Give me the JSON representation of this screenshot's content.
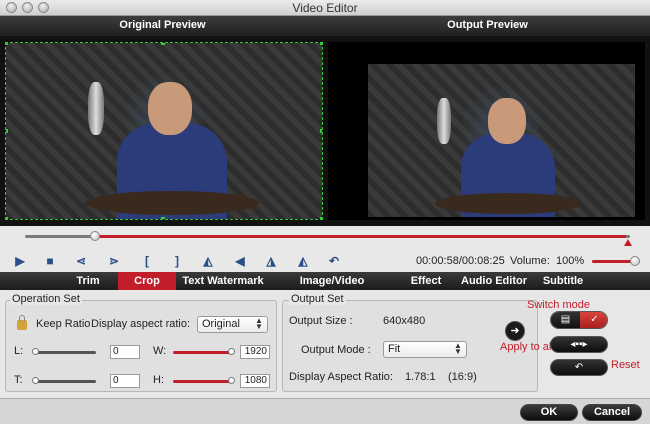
{
  "window": {
    "title": "Video Editor"
  },
  "preview": {
    "original_label": "Original Preview",
    "output_label": "Output Preview"
  },
  "playback": {
    "position_fraction": 0.115,
    "time_current": "00:00:58",
    "time_total": "00:08:25",
    "time_text": "00:00:58/00:08:25",
    "volume_label": "Volume:",
    "volume_value": "100%",
    "volume_fraction": 1.0,
    "buttons": [
      "play-icon",
      "stop-icon",
      "trim-start-icon",
      "trim-end-icon",
      "mark-in-icon",
      "mark-out-icon",
      "flip-horizontal-icon",
      "flip-vertical-icon",
      "rotate-left-icon",
      "rotate-right-icon",
      "undo-icon"
    ]
  },
  "tabs": [
    {
      "label": "Trim"
    },
    {
      "label": "Crop",
      "active": true
    },
    {
      "label": "Text Watermark"
    },
    {
      "label": "Image/Video Watermark"
    },
    {
      "label": "Effect"
    },
    {
      "label": "Audio Editor"
    },
    {
      "label": "Subtitle"
    }
  ],
  "operation_set": {
    "title": "Operation Set",
    "keep_ratio_label": "Keep Ratio",
    "display_aspect_label": "Display aspect ratio:",
    "display_aspect_value": "Original",
    "L_label": "L:",
    "L_value": "0",
    "W_label": "W:",
    "W_value": "1920",
    "T_label": "T:",
    "T_value": "0",
    "H_label": "H:",
    "H_value": "1080"
  },
  "output_set": {
    "title": "Output Set",
    "size_label": "Output Size :",
    "size_value": "640x480",
    "mode_label": "Output Mode :",
    "mode_value": "Fit",
    "dar_label": "Display Aspect Ratio:",
    "dar_value": "1.78:1",
    "dar_extra": "(16:9)"
  },
  "side": {
    "switch_mode": "Switch mode",
    "apply_to_all": "Apply to all",
    "reset": "Reset"
  },
  "footer": {
    "ok": "OK",
    "cancel": "Cancel"
  },
  "colors": {
    "accent": "#c21e2a",
    "crop_border": "#39c63a",
    "icon_blue": "#2d4f88"
  }
}
